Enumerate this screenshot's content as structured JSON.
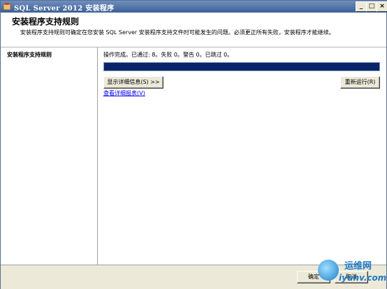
{
  "window": {
    "title": "SQL Server 2012 安装程序",
    "controls": {
      "minimize": "_",
      "maximize": "□",
      "close": "×"
    }
  },
  "header": {
    "title": "安装程序支持规则",
    "description": "安装程序支持规则可确定在您安装 SQL Server 安装程序支持文件时可能发生的问题。必须更正所有失败，安装程序才能继续。"
  },
  "sidebar": {
    "items": [
      {
        "label": "安装程序支持规则",
        "selected": true
      }
    ]
  },
  "main": {
    "status_text": "操作完成。已通过: 8。失败 0。警告 0。已跳过 0。",
    "progress": {
      "fraction": 1.0,
      "color": "#0a246a"
    },
    "show_details_label": "显示详细信息(S) >>",
    "rerun_label": "重新运行(R)",
    "view_report_link": "查看详细报表(V)"
  },
  "footer": {
    "ok_label": "确定",
    "cancel_label": "取消"
  },
  "watermark": {
    "line1": "运维网",
    "line2": "iyunv.com"
  }
}
